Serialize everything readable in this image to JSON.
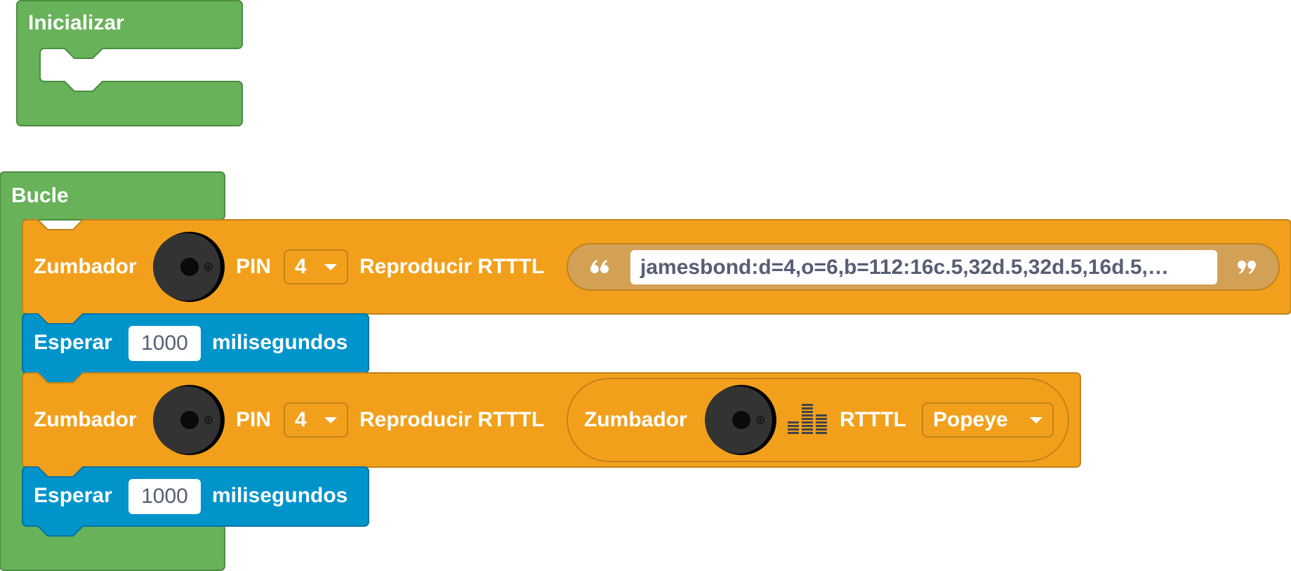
{
  "blocks": {
    "init": {
      "label": "Inicializar"
    },
    "loop": {
      "label": "Bucle"
    },
    "play_1": {
      "label": "Zumbador",
      "pin_label": "PIN",
      "pin_value": "4",
      "action_label": "Reproducir RTTTL",
      "string_value": "jamesbond:d=4,o=6,b=112:16c.5,32d.5,32d.5,16d.5,…"
    },
    "wait_1": {
      "label": "Esperar",
      "value": "1000",
      "unit": "milisegundos"
    },
    "play_2": {
      "label": "Zumbador",
      "pin_label": "PIN",
      "pin_value": "4",
      "action_label": "Reproducir RTTTL",
      "inner": {
        "label": "Zumbador",
        "type_label": "RTTTL",
        "melody": "Popeye"
      }
    },
    "wait_2": {
      "label": "Esperar",
      "value": "1000",
      "unit": "milisegundos"
    }
  },
  "icons": {
    "buzzer": "buzzer-icon",
    "levels": "sound-levels-icon",
    "dropdown": "chevron-down-icon",
    "open_quote": "open-quote-icon",
    "close_quote": "close-quote-icon"
  },
  "colors": {
    "event_block": "#68b25a",
    "event_border": "#4a8c3f",
    "buzzer_block": "#f2a01c",
    "buzzer_border": "#c0831b",
    "wait_block": "#0094cb",
    "wait_border": "#0074a3",
    "string_block": "#d3a155"
  }
}
